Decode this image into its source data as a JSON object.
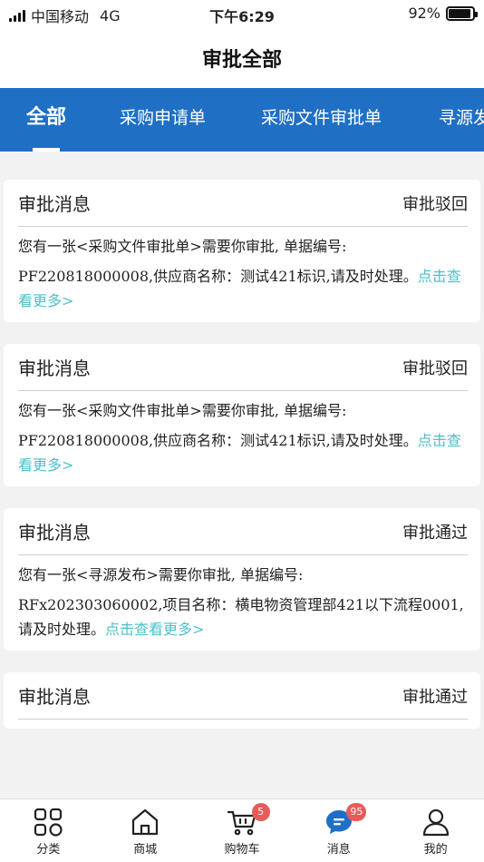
{
  "status_bar": {
    "carrier": "中国移动",
    "network": "4G",
    "time": "下午6:29",
    "battery": "92%",
    "battery_level": 0.92
  },
  "header": {
    "title": "审批全部"
  },
  "tabs": [
    {
      "label": "全部",
      "active": true
    },
    {
      "label": "采购申请单",
      "active": false
    },
    {
      "label": "采购文件审批单",
      "active": false
    },
    {
      "label": "寻源发",
      "active": false
    }
  ],
  "cards": [
    {
      "title": "审批消息",
      "status": "审批驳回",
      "line1": "您有一张<采购文件审批单>需要你审批, 单据编号:",
      "line2": "PF220818000008,供应商名称：测试421标识,请及时处理。",
      "more": "点击查看更多>"
    },
    {
      "title": "审批消息",
      "status": "审批驳回",
      "line1": "您有一张<采购文件审批单>需要你审批, 单据编号:",
      "line2": "PF220818000008,供应商名称：测试421标识,请及时处理。",
      "more": "点击查看更多>"
    },
    {
      "title": "审批消息",
      "status": "审批通过",
      "line1": "您有一张<寻源发布>需要你审批, 单据编号:",
      "line2": "RFx202303060002,项目名称：横电物资管理部421以下流程0001,请及时处理。",
      "more": "点击查看更多>"
    },
    {
      "title": "审批消息",
      "status": "审批通过"
    }
  ],
  "tabbar": [
    {
      "label": "分类",
      "icon": "category-icon"
    },
    {
      "label": "商城",
      "icon": "home-icon"
    },
    {
      "label": "购物车",
      "icon": "cart-icon",
      "badge": "5"
    },
    {
      "label": "消息",
      "icon": "message-icon",
      "badge": "95",
      "active": true
    },
    {
      "label": "我的",
      "icon": "user-icon"
    }
  ],
  "colors": {
    "accent": "#1f6fc5",
    "link": "#4cc0c9",
    "badge": "#e85b5b",
    "message_icon": "#1f6fc5"
  }
}
